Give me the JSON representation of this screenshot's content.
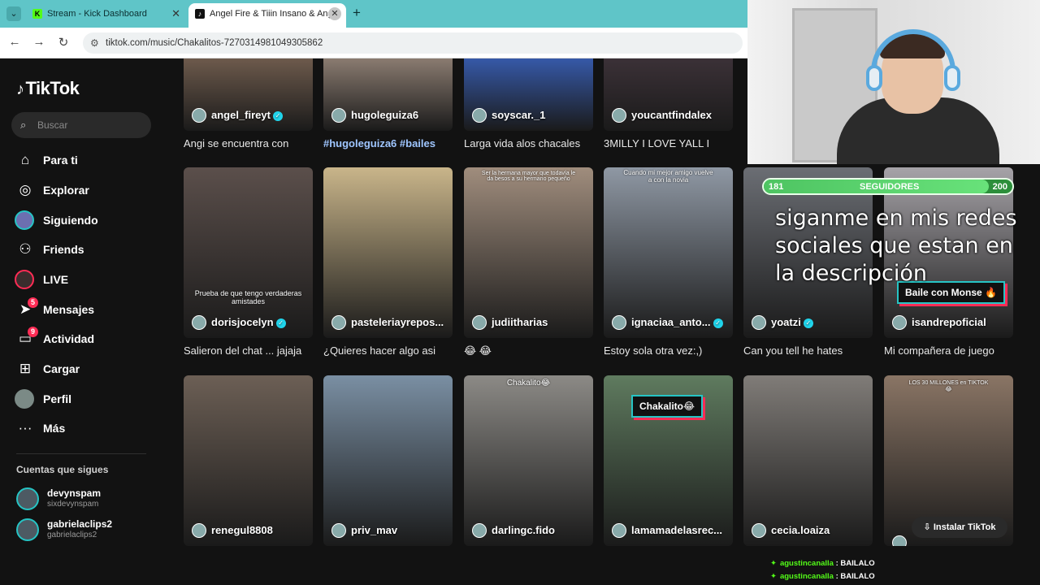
{
  "browser": {
    "tabs": [
      {
        "title": "Stream - Kick Dashboard",
        "favicon": "K"
      },
      {
        "title": "Angel Fire & Tiiin Insano & Ang",
        "favicon": "♪"
      }
    ],
    "url": "tiktok.com/music/Chakalitos-7270314981049305862"
  },
  "sidebar": {
    "logo": "TikTok",
    "search_placeholder": "Buscar",
    "nav": [
      {
        "label": "Para ti",
        "icon": "home-icon",
        "glyph": "⌂"
      },
      {
        "label": "Explorar",
        "icon": "compass-icon",
        "glyph": "◎"
      },
      {
        "label": "Siguiendo",
        "icon": "avatar-icon"
      },
      {
        "label": "Friends",
        "icon": "friends-icon",
        "glyph": "⚇"
      },
      {
        "label": "LIVE",
        "icon": "live-icon"
      },
      {
        "label": "Mensajes",
        "icon": "send-icon",
        "glyph": "➤",
        "badge": "5"
      },
      {
        "label": "Actividad",
        "icon": "inbox-icon",
        "glyph": "▭",
        "badge": "9"
      },
      {
        "label": "Cargar",
        "icon": "plus-icon",
        "glyph": "⊞"
      },
      {
        "label": "Perfil",
        "icon": "profile-icon"
      },
      {
        "label": "Más",
        "icon": "more-icon",
        "glyph": "···"
      }
    ],
    "following_title": "Cuentas que sigues",
    "following": [
      {
        "name": "devynspam",
        "handle": "sixdevynspam"
      },
      {
        "name": "gabrielaclips2",
        "handle": "gabrielaclips2"
      }
    ]
  },
  "videos_top": [
    {
      "user": "angel_fireyt",
      "verified": true,
      "caption": "Angi se encuentra con",
      "color": "#6d5a4c"
    },
    {
      "user": "hugoleguiza6",
      "verified": false,
      "caption": "#hugoleguiza6 #bailes",
      "tags": true,
      "color": "#8a7b70"
    },
    {
      "user": "soyscar._1",
      "verified": false,
      "caption": "Larga vida alos chacales",
      "color": "#3659a8"
    },
    {
      "user": "youcantfindalex",
      "verified": false,
      "caption": "3MILLY I LOVE YALL I",
      "color": "#3b3137"
    }
  ],
  "videos_mid": [
    {
      "user": "dorisjocelyn",
      "verified": true,
      "caption": "Salieron del chat ... jajaja",
      "overlay": "Prueba de que tengo verdaderas amistades",
      "color": "#5b4f4b"
    },
    {
      "user": "pasteleriayrepos...",
      "verified": false,
      "caption": "¿Quieres hacer algo asi",
      "color": "#c9b58a"
    },
    {
      "user": "judiitharias",
      "verified": false,
      "caption": "😂 😂",
      "overlay": "Ser la hermana mayor que todavía le da besos a su hermano pequeño",
      "color": "#a08d7d"
    },
    {
      "user": "ignaciaa_anto...",
      "verified": true,
      "caption": "Estoy sola otra vez:,)",
      "overlay": "Cuando mi mejor amigo vuelve a con la novia",
      "color": "#8f98a4"
    },
    {
      "user": "yoatzi",
      "verified": true,
      "caption": "Can you tell he hates",
      "color": "#6b6e74"
    },
    {
      "user": "isandrepoficial",
      "verified": false,
      "caption": "Mi compañera de juego",
      "sticker": "Baile con Monse 🔥",
      "color": "#a6a3a8"
    }
  ],
  "videos_bottom": [
    {
      "user": "renegul8808",
      "color": "#6c5f55"
    },
    {
      "user": "priv_mav",
      "color": "#7a8fa3"
    },
    {
      "user": "darlingc.fido",
      "overlay": "Chakalito😂",
      "color": "#8c8a86"
    },
    {
      "user": "lamamadelasrec...",
      "sticker": "Chakalito😂",
      "color": "#5f7b5f"
    },
    {
      "user": "cecia.loaiza",
      "color": "#807c78"
    },
    {
      "user": "",
      "overlay": "LOS 30 MILLONES en TIKTOK 😂",
      "color": "#8a7565"
    }
  ],
  "install_label": "Instalar TikTok",
  "stream_overlay": {
    "followers_label": "SEGUIDORES",
    "followers_current": "181",
    "followers_goal": "200",
    "progress": 0.905,
    "message": "siganme en mis redes sociales que estan en la descripción"
  },
  "chat": [
    {
      "user": "agustincanalla",
      "sep": " : ",
      "message": "BAILALO"
    },
    {
      "user": "agustincanalla",
      "sep": " : ",
      "message": "BAILALO"
    }
  ]
}
